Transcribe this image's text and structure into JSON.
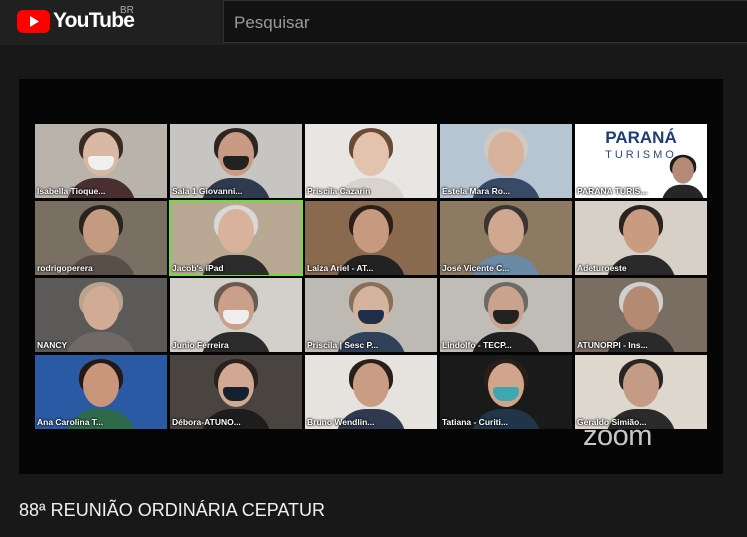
{
  "header": {
    "logo_text": "YouTube",
    "region": "BR",
    "search_placeholder": "Pesquisar"
  },
  "video": {
    "title": "88ª REUNIÃO ORDINÁRIA CEPATUR",
    "watermark": "zoom",
    "banner_line1": "PARANÁ",
    "banner_line2": "TURISMO",
    "participants": [
      "Isabella Tioque...",
      "Sala 1 Giovanni...",
      "Priscila Cazarin",
      "Estela Mara Ro...",
      "PARANA TURIS...",
      "rodrigoperera",
      "Jacob's iPad",
      "Laiza Ariel - AT...",
      "José Vicente C...",
      "Adeturoeste",
      "NANCY",
      "Junio Férreira",
      "Priscila | Sesc P...",
      "Lindolfo - TECP...",
      "ATUNORPI - Ins...",
      "Ana Carolina T...",
      "Débora-ATUNO...",
      "Bruno Wendlin...",
      "Tatiana - Curiti...",
      "Geraldo Simião..."
    ]
  }
}
